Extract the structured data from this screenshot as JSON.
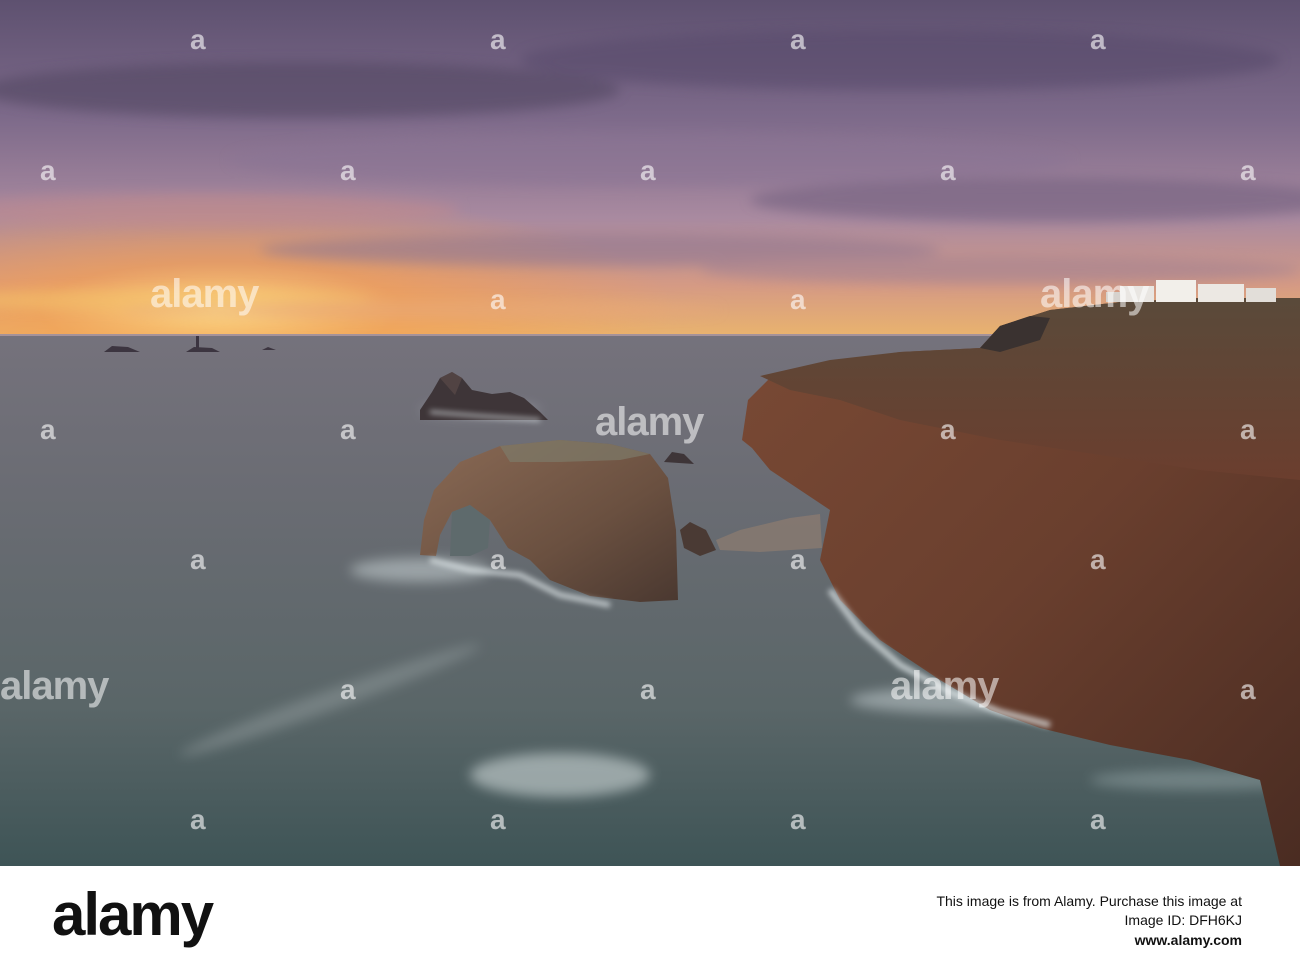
{
  "watermark": {
    "text": "alamy",
    "mark": "a"
  },
  "footer": {
    "brand": "alamy",
    "caption": "This image is from Alamy. Purchase this image at",
    "image_id": "Image ID: DFH6KJ",
    "url": "www.alamy.com"
  },
  "colors": {
    "sky_top": "#6f5f7c",
    "sunset": "#f4b24a",
    "sea": "#5d6c6e",
    "cliff": "#6a3f2c"
  }
}
